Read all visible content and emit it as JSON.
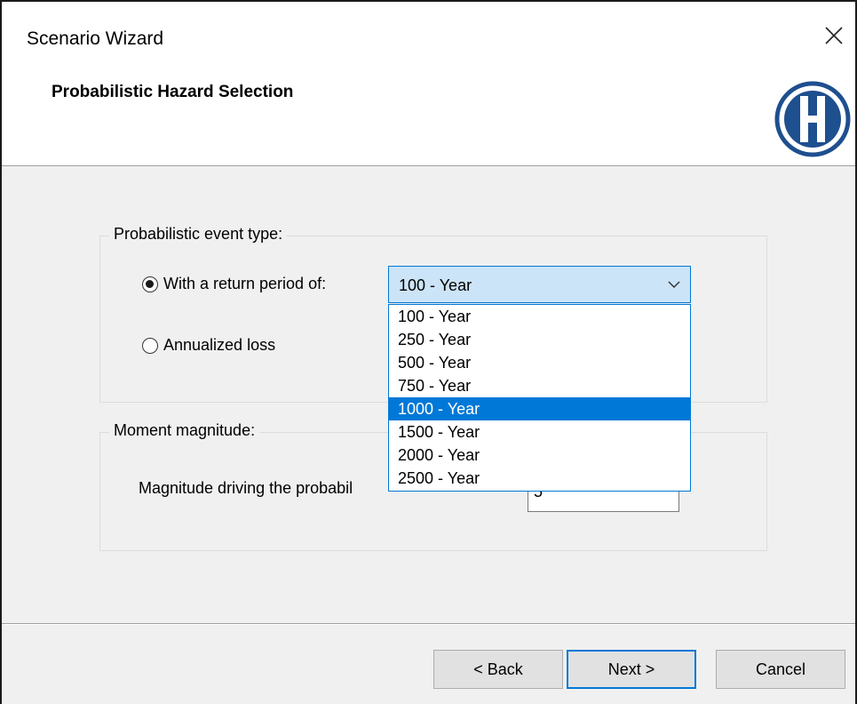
{
  "window": {
    "title": "Scenario Wizard",
    "close_symbol": "✕"
  },
  "header": {
    "title": "Probabilistic Hazard Selection",
    "logo_icon": "hazus-h-logo",
    "logo_color": "#1e4f8f"
  },
  "event_type_group": {
    "legend": "Probabilistic event type:",
    "return_period_radio": {
      "label": "With a return period of:",
      "checked": true
    },
    "annualized_radio": {
      "label": "Annualized loss",
      "checked": false
    },
    "return_period_combo": {
      "selected_value": "100 - Year",
      "options": [
        "100 - Year",
        "250 - Year",
        "500 - Year",
        "750 - Year",
        "1000 - Year",
        "1500 - Year",
        "2000 - Year",
        "2500 - Year"
      ],
      "highlighted_option": "1000 - Year"
    }
  },
  "magnitude_group": {
    "legend": "Moment magnitude:",
    "label": "Magnitude driving the probabil",
    "value": "5"
  },
  "footer": {
    "back_label": "< Back",
    "next_label": "Next >",
    "cancel_label": "Cancel"
  },
  "colors": {
    "accent": "#0078d7",
    "combo_bg": "#cce4f7"
  }
}
